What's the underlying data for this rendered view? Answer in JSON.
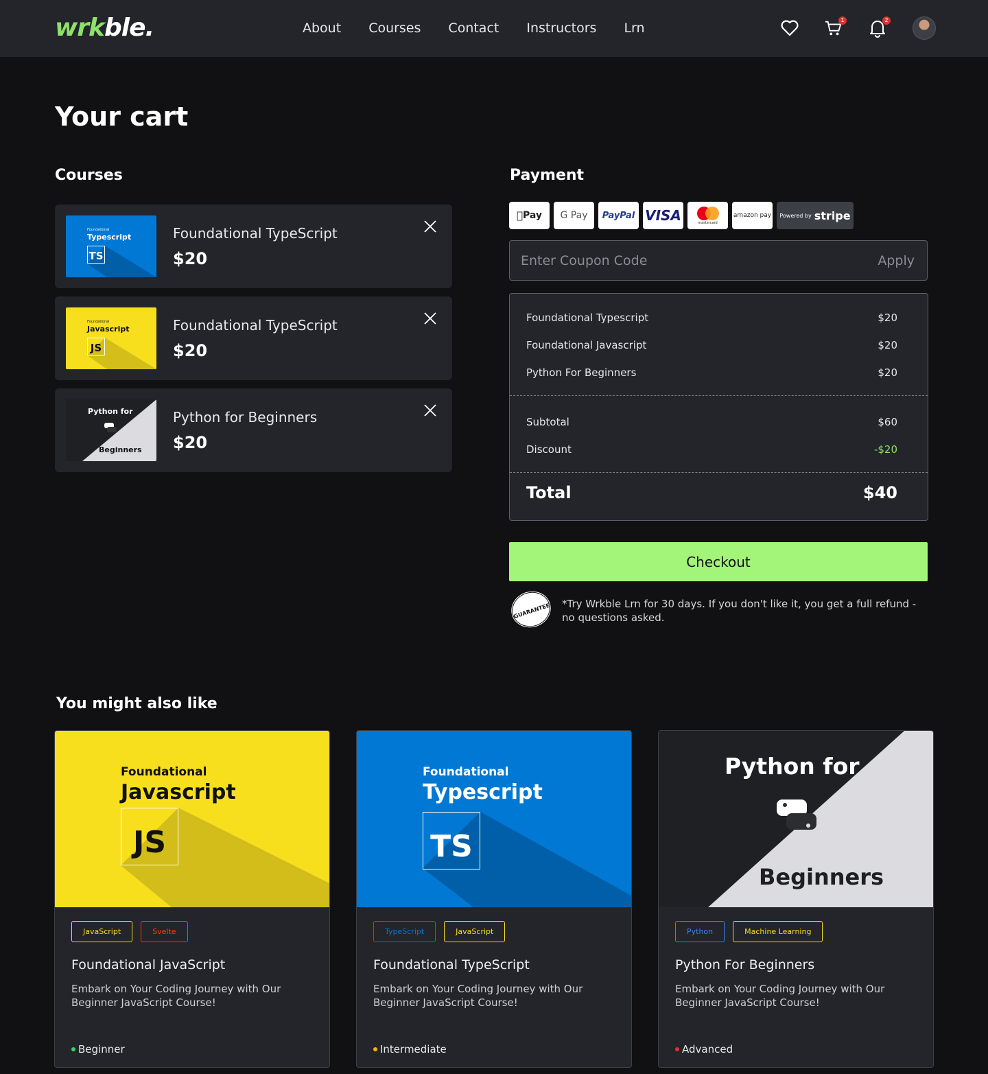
{
  "header": {
    "logo_green": "wrk",
    "logo_white": "ble.",
    "nav": [
      "About",
      "Courses",
      "Contact",
      "Instructors",
      "Lrn"
    ],
    "cart_count": "1",
    "notif_count": "2"
  },
  "page_title": "Your cart",
  "courses_title": "Courses",
  "cart": [
    {
      "thumb_small": "Foundational",
      "thumb_big": "Typescript",
      "thumb_box": "TS",
      "name": "Foundational TypeScript",
      "price": "$20"
    },
    {
      "thumb_small": "Foundational",
      "thumb_big": "Javascript",
      "thumb_box": "JS",
      "name": "Foundational TypeScript",
      "price": "$20"
    },
    {
      "thumb_small": "Python for",
      "thumb_big": "Beginners",
      "name": "Python for Beginners",
      "price": "$20"
    }
  ],
  "payment": {
    "title": "Payment",
    "logos": [
      "Pay",
      "G Pay",
      "PayPal",
      "VISA",
      "mastercard",
      "amazon pay"
    ],
    "stripe_small": "Powered by",
    "stripe": "stripe",
    "coupon_placeholder": "Enter Coupon Code",
    "apply": "Apply",
    "lines": [
      {
        "label": "Foundational Typescript",
        "value": "$20"
      },
      {
        "label": "Foundational Javascript",
        "value": "$20"
      },
      {
        "label": "Python For Beginners",
        "value": "$20"
      }
    ],
    "subtotal_label": "Subtotal",
    "subtotal": "$60",
    "discount_label": "Discount",
    "discount": "-$20",
    "total_label": "Total",
    "total": "$40",
    "checkout": "Checkout",
    "guarantee_badge": "GUARANTEE",
    "guarantee_text": "*Try Wrkble Lrn for 30 days. If you don't like it, you get a full refund - no questions asked."
  },
  "recommend": {
    "title": "You might also like",
    "cards": [
      {
        "img_small": "Foundational",
        "img_big": "Javascript",
        "img_box": "JS",
        "tags": [
          "JavaScript",
          "Svelte"
        ],
        "title": "Foundational JavaScript",
        "desc": "Embark on Your Coding Journey with Our Beginner JavaScript Course!",
        "level": "Beginner"
      },
      {
        "img_small": "Foundational",
        "img_big": "Typescript",
        "img_box": "TS",
        "tags": [
          "TypeScript",
          "JavaScript"
        ],
        "title": "Foundational TypeScript",
        "desc": "Embark on Your Coding Journey with Our Beginner JavaScript Course!",
        "level": "Intermediate"
      },
      {
        "img_small": "Python for",
        "img_big": "Beginners",
        "tags": [
          "Python",
          "Machine Learning"
        ],
        "title": "Python For Beginners",
        "desc": "Embark on Your Coding Journey with Our Beginner JavaScript Course!",
        "level": "Advanced"
      }
    ]
  },
  "colors": {
    "accent_green": "#a3f57a",
    "ts_blue": "#0178d4",
    "js_yellow": "#f7df1e",
    "level_beginner": "#3ecf6a",
    "level_intermediate": "#f5b400",
    "level_advanced": "#e03131"
  }
}
